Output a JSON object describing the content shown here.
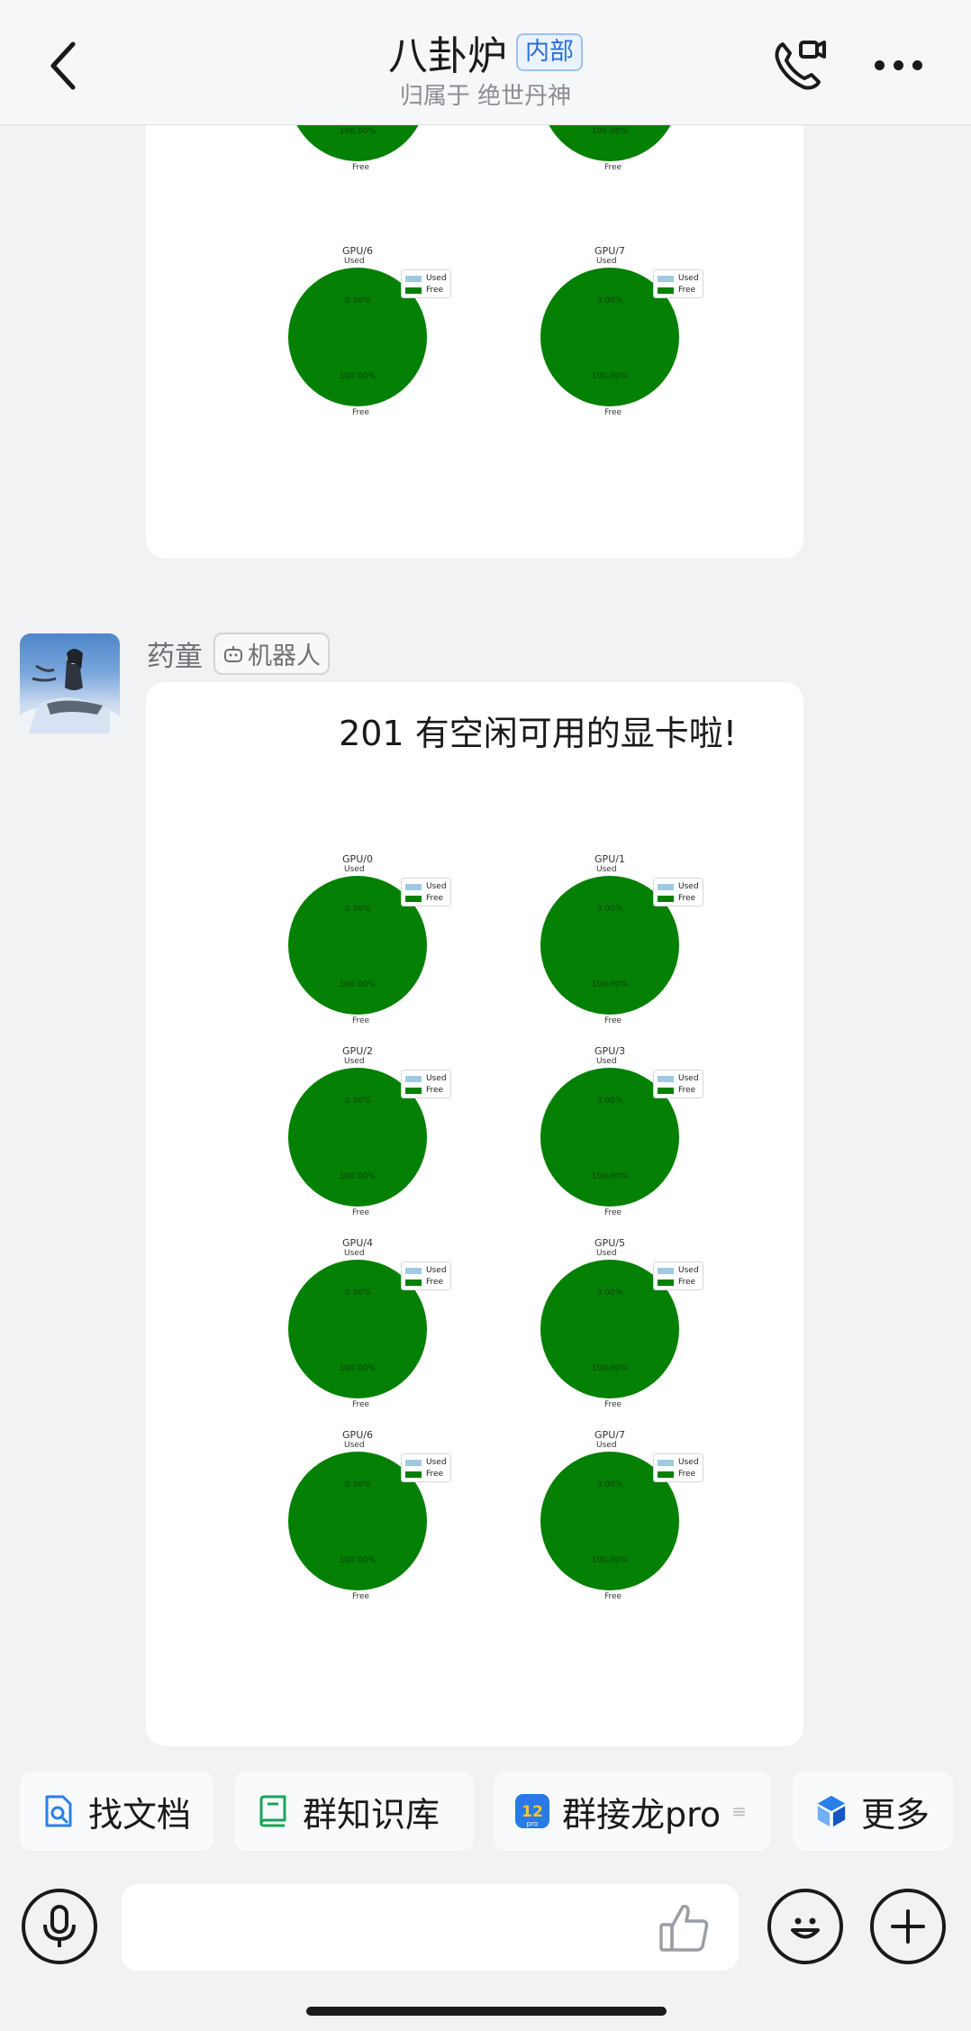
{
  "header": {
    "title": "八卦炉",
    "badge": "内部",
    "subtitle": "归属于 绝世丹神"
  },
  "charts_common": {
    "used_label": "Used",
    "free_label": "Free",
    "used_pct": "0.00%",
    "free_pct": "100.00%",
    "used_color": "#9ecae1",
    "free_color": "#048004"
  },
  "message1": {
    "charts": [
      {
        "title": "GPU/6"
      },
      {
        "title": "GPU/7"
      }
    ]
  },
  "message2": {
    "sender": "药童",
    "bot_tag": "机器人",
    "text": "201 有空闲可用的显卡啦!",
    "charts": [
      {
        "title": "GPU/0"
      },
      {
        "title": "GPU/1"
      },
      {
        "title": "GPU/2"
      },
      {
        "title": "GPU/3"
      },
      {
        "title": "GPU/4"
      },
      {
        "title": "GPU/5"
      },
      {
        "title": "GPU/6"
      },
      {
        "title": "GPU/7"
      }
    ]
  },
  "chart_data": [
    {
      "type": "pie",
      "title": "GPU/0",
      "categories": [
        "Used",
        "Free"
      ],
      "values": [
        0.0,
        100.0
      ]
    },
    {
      "type": "pie",
      "title": "GPU/1",
      "categories": [
        "Used",
        "Free"
      ],
      "values": [
        0.0,
        100.0
      ]
    },
    {
      "type": "pie",
      "title": "GPU/2",
      "categories": [
        "Used",
        "Free"
      ],
      "values": [
        0.0,
        100.0
      ]
    },
    {
      "type": "pie",
      "title": "GPU/3",
      "categories": [
        "Used",
        "Free"
      ],
      "values": [
        0.0,
        100.0
      ]
    },
    {
      "type": "pie",
      "title": "GPU/4",
      "categories": [
        "Used",
        "Free"
      ],
      "values": [
        0.0,
        100.0
      ]
    },
    {
      "type": "pie",
      "title": "GPU/5",
      "categories": [
        "Used",
        "Free"
      ],
      "values": [
        0.0,
        100.0
      ]
    },
    {
      "type": "pie",
      "title": "GPU/6",
      "categories": [
        "Used",
        "Free"
      ],
      "values": [
        0.0,
        100.0
      ]
    },
    {
      "type": "pie",
      "title": "GPU/7",
      "categories": [
        "Used",
        "Free"
      ],
      "values": [
        0.0,
        100.0
      ]
    }
  ],
  "quick_bar": {
    "items": [
      {
        "label": "找文档",
        "icon": "doc-search-icon"
      },
      {
        "label": "群知识库",
        "icon": "knowledge-book-icon"
      },
      {
        "label": "群接龙pro",
        "icon": "relay-app-icon"
      },
      {
        "label": "更多",
        "icon": "cube-apps-icon"
      }
    ]
  },
  "input": {
    "placeholder": ""
  }
}
